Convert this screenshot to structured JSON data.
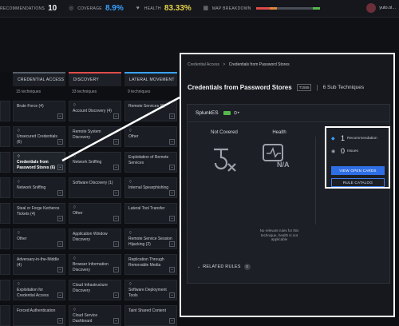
{
  "topbar": {
    "recommendations_label": "RECOMMENDATIONS",
    "recommendations_value": "10",
    "coverage_label": "COVERAGE",
    "coverage_value": "8.9%",
    "health_label": "HEALTH",
    "health_value": "83.33%",
    "map_label": "MAP BREAKDOWN",
    "user_name": "yuto.ol..."
  },
  "colors": {
    "accent": "#2f6fe6",
    "coverage": "#3aa1ff",
    "health": "#e8d24a",
    "enabled": "#55b94a"
  },
  "matrix": {
    "columns": [
      {
        "name": "CREDENTIAL ACCESS",
        "count": "15 techniques"
      },
      {
        "name": "DISCOVERY",
        "count": "33 techniques"
      },
      {
        "name": "LATERAL MOVEMENT",
        "count": "9 techniques"
      }
    ],
    "rows": [
      [
        "Brute Force (4)",
        "Account Discovery (4)",
        "Remote Services (6)"
      ],
      [
        "Unsecured Credentials (6)",
        "Remote System Discovery",
        "Other"
      ],
      [
        "Credentials from Password Stores (6)",
        "Network Sniffing",
        "Exploitation of Remote Services"
      ],
      [
        "Network Sniffing",
        "Software Discovery (1)",
        "Internal Spearphishing"
      ],
      [
        "Steal or Forge Kerberos Tickets (4)",
        "Other",
        "Lateral Tool Transfer"
      ],
      [
        "Other",
        "Application Window Discovery",
        "Remote Service Session Hijacking (2)"
      ],
      [
        "Adversary-in-the-Middle (4)",
        "Browser Information Discovery",
        "Replication Through Removable Media"
      ],
      [
        "Exploitation for Credential Access",
        "Cloud Infrastructure Discovery",
        "Software Deployment Tools"
      ],
      [
        "Forced Authentication",
        "Cloud Service Dashboard",
        "Taint Shared Content"
      ]
    ]
  },
  "panel": {
    "breadcrumb_root": "Credential Access",
    "breadcrumb_sep": ">",
    "breadcrumb_current": "Credentials from Password Stores",
    "title": "Credentials from Password Stores",
    "technique_id": "T1555",
    "divider": "|",
    "sub_techniques": "6 Sub Techniques",
    "integration_name": "SplunkES",
    "not_covered_label": "Not Covered",
    "health_label": "Health",
    "health_na": "N/A",
    "health_note": "No relevant rules for this technique, health is not applicable",
    "recommendation_count": "1",
    "recommendation_label": "Recommendation",
    "issues_count": "0",
    "issues_label": "Issues",
    "view_cards_button": "VIEW OPEN CARDS",
    "rule_catalog_button": "RULE CATALOG",
    "related_rules_label": "RELATED RULES",
    "related_rules_count": "0"
  }
}
